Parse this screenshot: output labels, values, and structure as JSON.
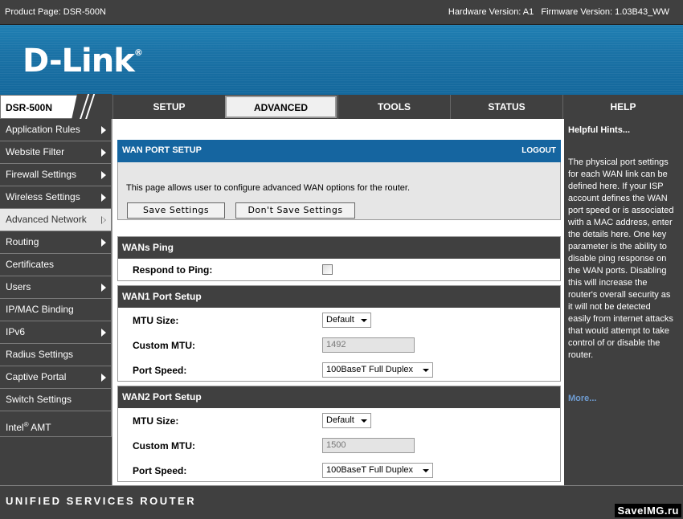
{
  "top": {
    "product_page": "Product Page: DSR-500N",
    "versions": "Hardware Version: A1   Firmware Version: 1.03B43_WW"
  },
  "brand": {
    "logo": "D-Link",
    "reg": "®"
  },
  "model": "DSR-500N",
  "tabs": [
    {
      "label": "SETUP"
    },
    {
      "label": "ADVANCED"
    },
    {
      "label": "TOOLS"
    },
    {
      "label": "STATUS"
    },
    {
      "label": "HELP"
    }
  ],
  "sidebar": {
    "items": [
      {
        "label": "Application Rules"
      },
      {
        "label": "Website Filter"
      },
      {
        "label": "Firewall Settings"
      },
      {
        "label": "Wireless Settings"
      },
      {
        "label": "Advanced Network"
      },
      {
        "label": "Routing"
      },
      {
        "label": "Certificates"
      },
      {
        "label": "Users"
      },
      {
        "label": "IP/MAC Binding"
      },
      {
        "label": "IPv6"
      },
      {
        "label": "Radius Settings"
      },
      {
        "label": "Captive Portal"
      },
      {
        "label": "Switch Settings"
      },
      {
        "label": "Intel",
        "sup": "®",
        "suffix": " AMT"
      }
    ]
  },
  "main": {
    "title": "WAN PORT SETUP",
    "logout": "LOGOUT",
    "description": "This page allows user to configure advanced WAN options for the router.",
    "save_label": "Save Settings",
    "dont_save_label": "Don't Save Settings",
    "wans_ping": {
      "title": "WANs Ping",
      "respond_label": "Respond to Ping:"
    },
    "wan1": {
      "title": "WAN1 Port Setup",
      "mtu_label": "MTU Size:",
      "mtu_value": "Default",
      "custom_label": "Custom MTU:",
      "custom_value": "1492",
      "speed_label": "Port Speed:",
      "speed_value": "100BaseT Full Duplex"
    },
    "wan2": {
      "title": "WAN2 Port Setup",
      "mtu_label": "MTU Size:",
      "mtu_value": "Default",
      "custom_label": "Custom MTU:",
      "custom_value": "1500",
      "speed_label": "Port Speed:",
      "speed_value": "100BaseT Full Duplex"
    }
  },
  "hints": {
    "title": "Helpful Hints...",
    "body": "The physical port settings for each WAN link can be defined here. If your ISP account defines the WAN port speed or is associated with a MAC address, enter the details here. One key parameter is the ability to disable ping response on the WAN ports. Disabling this will increase the router's overall security as it will not be detected easily from internet attacks that would attempt to take control of or disable the router.",
    "more": "More..."
  },
  "footer": {
    "text": "UNIFIED SERVICES ROUTER"
  },
  "watermark": "SaveIMG.ru"
}
